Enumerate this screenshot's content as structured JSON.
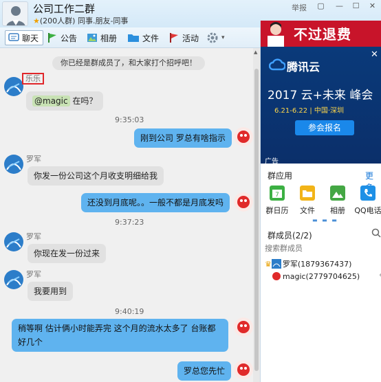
{
  "window": {
    "group_name": "公司工作二群",
    "member_count": "(200人群)",
    "group_tags": "同事.朋友-同事",
    "report_label": "举报"
  },
  "toolbar": {
    "items": [
      {
        "label": "聊天",
        "icon": "chat-icon"
      },
      {
        "label": "公告",
        "icon": "announcement-flag-icon"
      },
      {
        "label": "相册",
        "icon": "photo-album-icon"
      },
      {
        "label": "文件",
        "icon": "folder-icon"
      },
      {
        "label": "活动",
        "icon": "activity-flag-icon"
      },
      {
        "label": "",
        "icon": "gear-icon"
      }
    ]
  },
  "chat": {
    "notice": "你已经是群成员了，和大家打个招呼吧！",
    "messages": [
      {
        "side": "left",
        "sender": "乐乐",
        "mention": "@magic",
        "text": " 在吗？"
      },
      {
        "time": "9:35:03"
      },
      {
        "side": "right",
        "text": "刚到公司 罗总有啥指示"
      },
      {
        "side": "left",
        "sender": "罗军",
        "text": "你发一份公司这个月收支明细给我"
      },
      {
        "side": "right",
        "text": "还没到月底呢。。一般不都是月底发吗"
      },
      {
        "time": "9:37:23"
      },
      {
        "side": "left",
        "sender": "罗军",
        "text": "你现在发一份过来"
      },
      {
        "side": "left",
        "sender": "罗军",
        "text": "我要用到"
      },
      {
        "time": "9:40:19"
      },
      {
        "side": "right",
        "text": "稍等啊 估计俩小时能弄完 这个月的流水太多了 台账都好几个"
      },
      {
        "side": "right",
        "text": "罗总您先忙"
      }
    ]
  },
  "ads": {
    "top_banner": "不过退费",
    "tencent_logo": "腾讯云",
    "headline": "2017 云+未来 峰会",
    "date_place": "6.21-6.22 | 中国·深圳",
    "register_button": "参会报名",
    "ad_tag": "广告"
  },
  "apps": {
    "title": "群应用",
    "more": "更多",
    "items": [
      {
        "label": "群日历",
        "color": "#3cb043"
      },
      {
        "label": "文件",
        "color": "#f2b418"
      },
      {
        "label": "相册",
        "color": "#44a744"
      },
      {
        "label": "QQ电话",
        "color": "#1e90e6"
      }
    ]
  },
  "members": {
    "title": "群成员(2/2)",
    "search_placeholder": "搜索群成员",
    "list": [
      {
        "name": "罗军(1879367437)",
        "role": "owner"
      },
      {
        "name": "magic(2779704625)",
        "role": "self"
      }
    ]
  },
  "colors": {
    "self_bubble": "#5fb3ef",
    "other_bubble": "#e1e1e1",
    "highlight_box": "#e0262a"
  }
}
